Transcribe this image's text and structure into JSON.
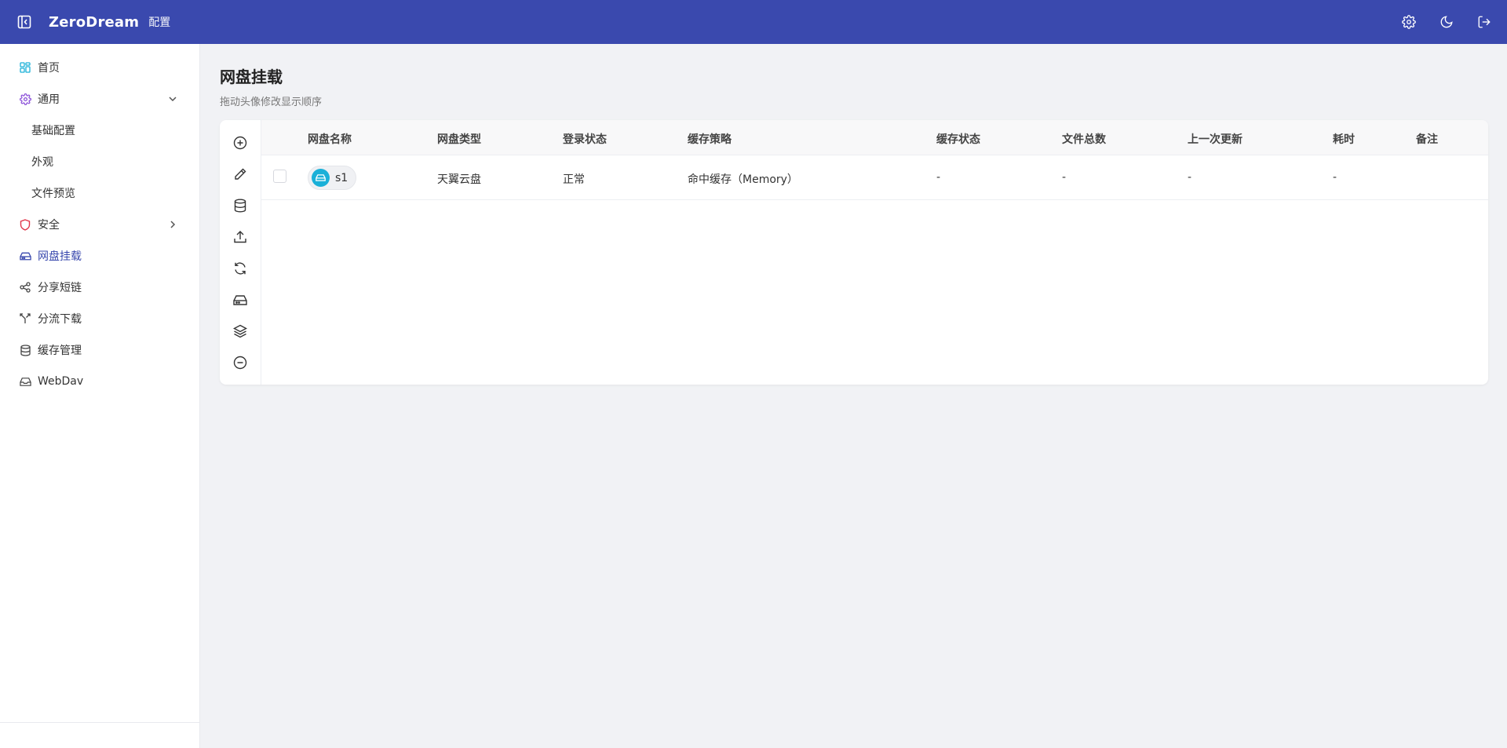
{
  "header": {
    "brand": "ZeroDream",
    "crumb": "配置",
    "icons": [
      "sidebar-collapse-icon",
      "gear-icon",
      "moon-icon",
      "logout-icon"
    ]
  },
  "sidebar": {
    "items": [
      {
        "label": "首页",
        "icon": "grid-icon"
      },
      {
        "label": "通用",
        "icon": "gear-icon",
        "expanded": true
      },
      {
        "label": "基础配置"
      },
      {
        "label": "外观"
      },
      {
        "label": "文件预览"
      },
      {
        "label": "安全",
        "icon": "shield-icon",
        "expanded": false
      },
      {
        "label": "网盘挂载",
        "icon": "drive-icon",
        "active": true
      },
      {
        "label": "分享短链",
        "icon": "share-icon"
      },
      {
        "label": "分流下载",
        "icon": "split-icon"
      },
      {
        "label": "缓存管理",
        "icon": "database-icon"
      },
      {
        "label": "WebDav",
        "icon": "inbox-icon"
      }
    ]
  },
  "page": {
    "title": "网盘挂载",
    "subtitle": "拖动头像修改显示顺序"
  },
  "toolbar": {
    "icons": [
      "add-icon",
      "edit-icon",
      "database-icon",
      "upload-icon",
      "refresh-icon",
      "drive-icon",
      "layers-icon",
      "remove-icon"
    ]
  },
  "table": {
    "columns": [
      "网盘名称",
      "网盘类型",
      "登录状态",
      "缓存策略",
      "缓存状态",
      "文件总数",
      "上一次更新",
      "耗时",
      "备注"
    ],
    "rows": [
      {
        "name": "s1",
        "type": "天翼云盘",
        "login": "正常",
        "cache_policy": "命中缓存（Memory）",
        "cache_status": "-",
        "file_count": "-",
        "last_update": "-",
        "duration": "-",
        "remark": ""
      }
    ]
  },
  "colors": {
    "topbar": "#3a49ae",
    "accent": "#3a49ae",
    "avatar": "#1ab0d8",
    "shield": "#e0364a",
    "gear": "#8a4fd8"
  }
}
